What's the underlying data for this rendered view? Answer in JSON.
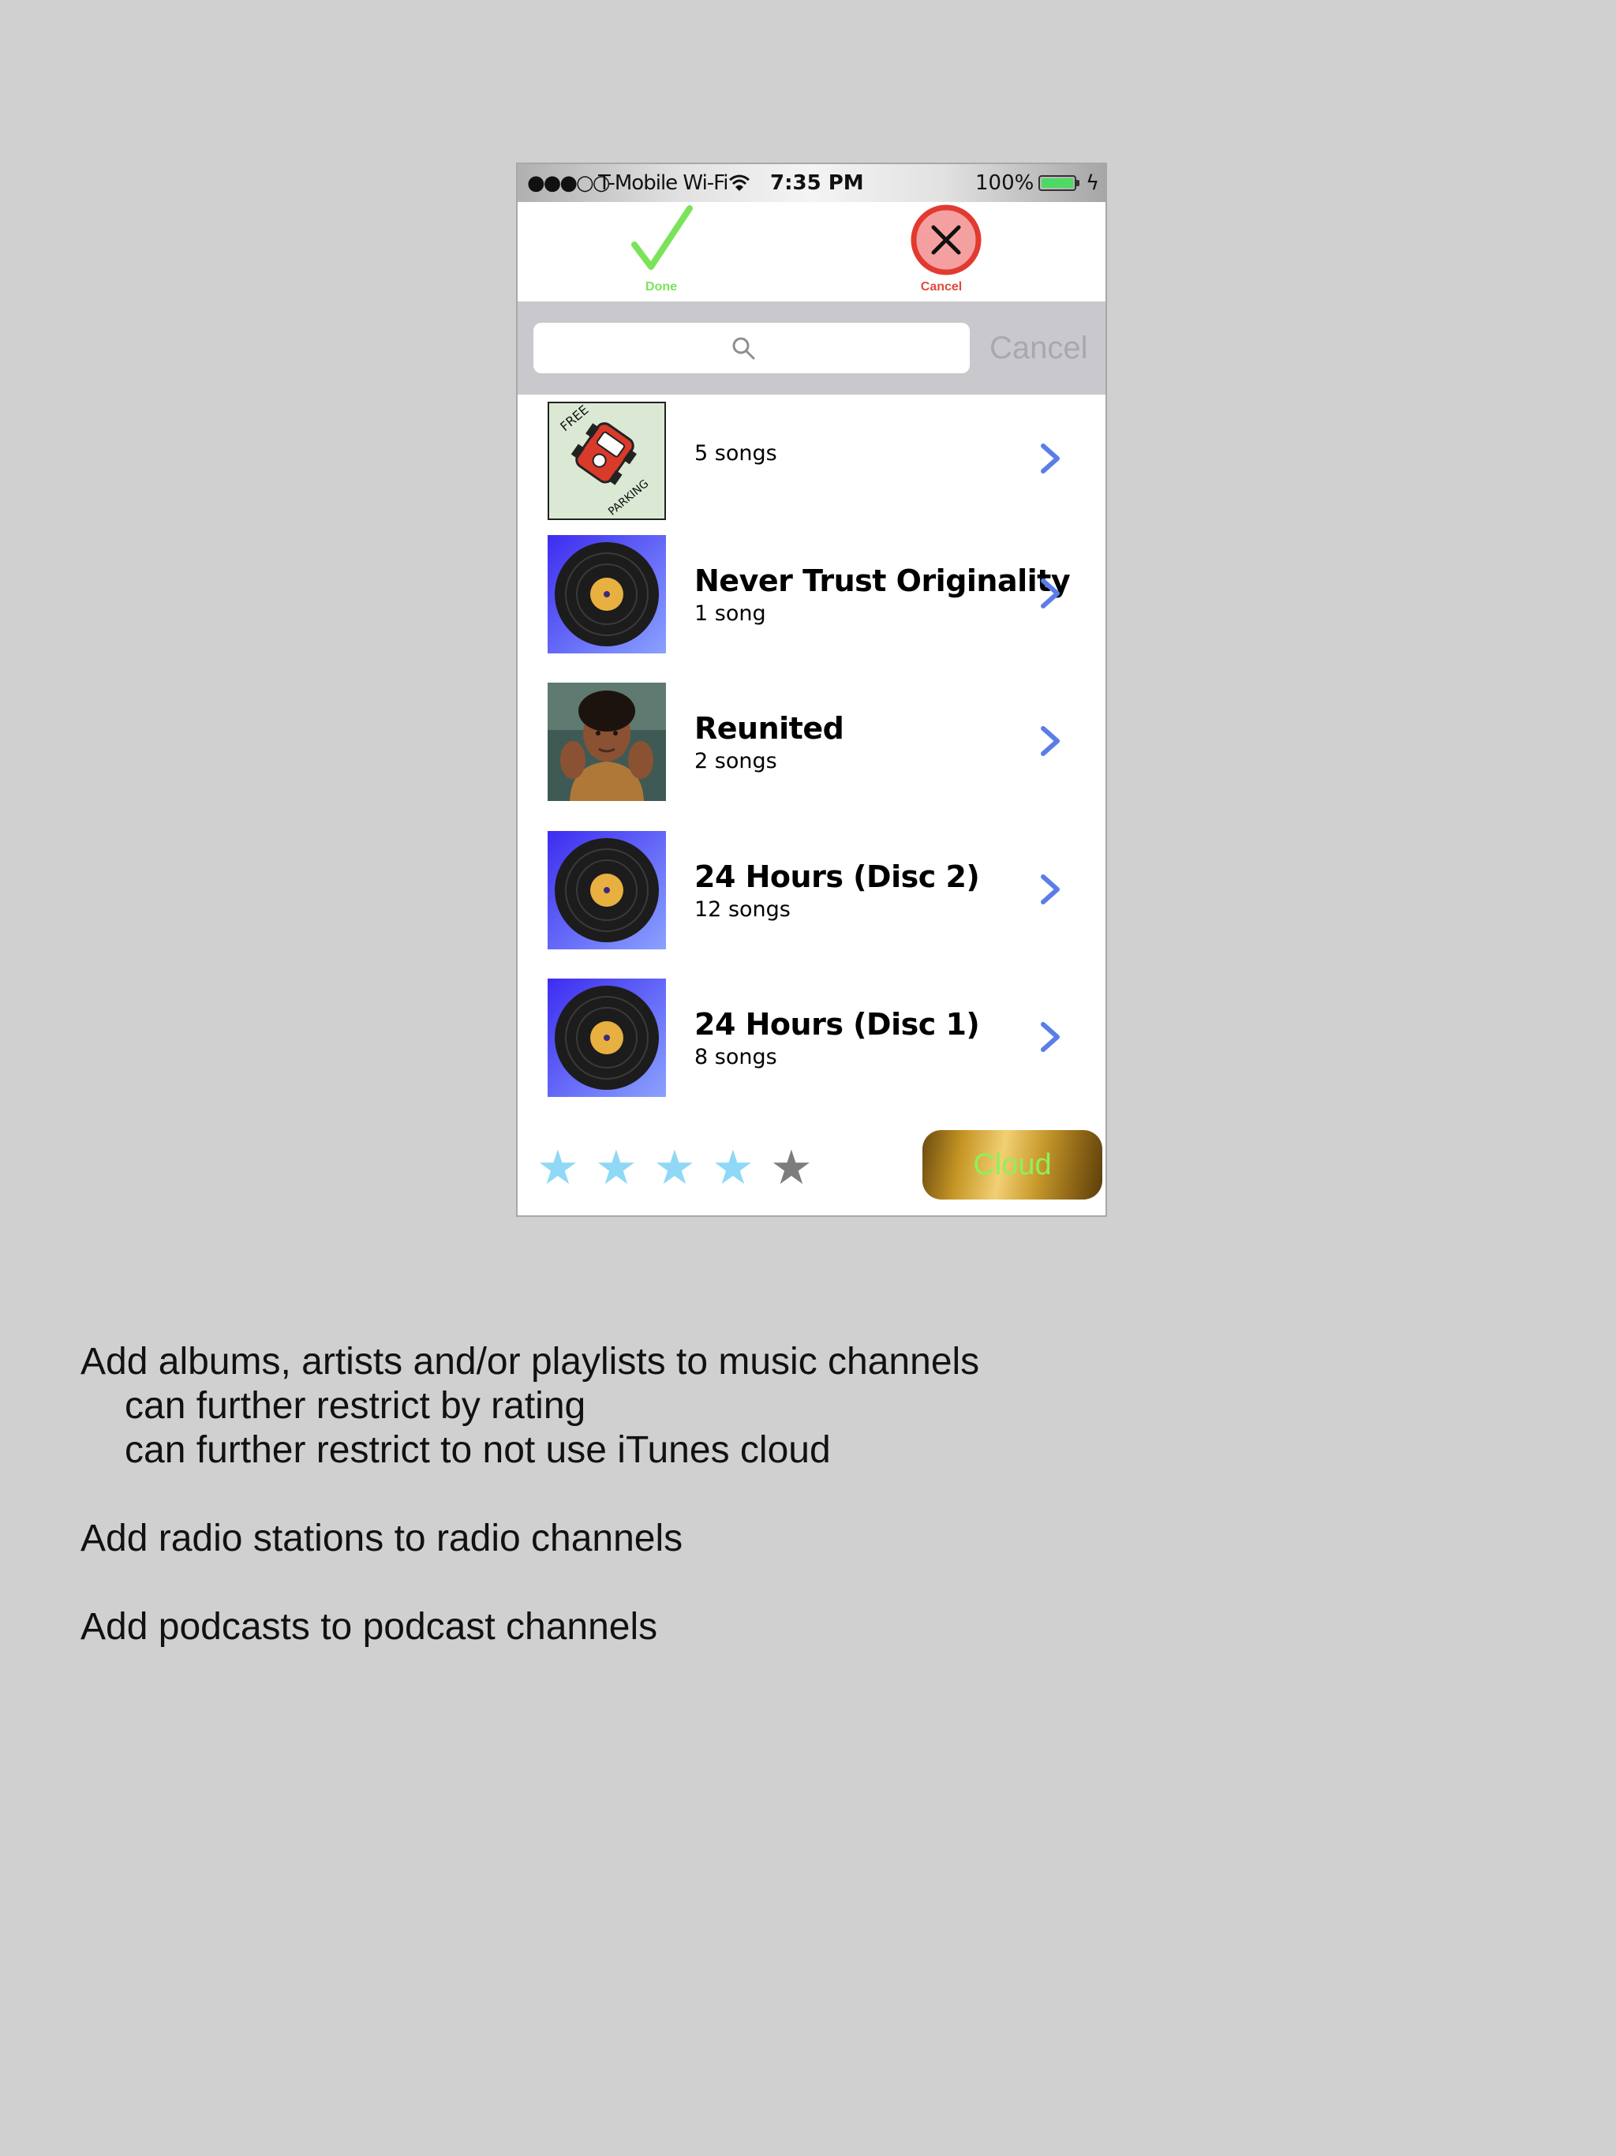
{
  "status_bar": {
    "signal": "●●●○○",
    "carrier": "T-Mobile Wi-Fi",
    "time": "7:35 PM",
    "battery_percent": "100%",
    "battery_level": 1.0,
    "charging_icon": "bolt-icon"
  },
  "toolbar": {
    "done_label": "Done",
    "cancel_label": "Cancel",
    "done_icon": "checkmark-icon",
    "cancel_icon": "x-circle-icon",
    "done_color": "#7be35a",
    "cancel_color": "#e04a3a"
  },
  "search": {
    "value": "",
    "placeholder": "",
    "cancel_label": "Cancel"
  },
  "albums": [
    {
      "title": "",
      "count": "5 songs",
      "art": "free-parking",
      "art_text_top": "FREE",
      "art_text_bottom": "PARKING"
    },
    {
      "title": "Never Trust Originality",
      "count": "1 song",
      "art": "vinyl-record"
    },
    {
      "title": "Reunited",
      "count": "2 songs",
      "art": "portrait-photo"
    },
    {
      "title": "24 Hours (Disc 2)",
      "count": "12 songs",
      "art": "vinyl-record"
    },
    {
      "title": "24 Hours (Disc 1)",
      "count": "8 songs",
      "art": "vinyl-record"
    }
  ],
  "rating": {
    "stars": [
      "★",
      "★",
      "★",
      "★",
      "★"
    ],
    "value": 4,
    "max": 5,
    "on_color": "#8fd8f6",
    "off_color": "#7d7d7d"
  },
  "cloud_button": {
    "label": "Cloud"
  },
  "description": {
    "music_line": "Add albums, artists and/or playlists to music channels",
    "rating_line": "can further restrict by rating",
    "cloud_line": "can further restrict to not use iTunes cloud",
    "radio_line": "Add radio stations to radio channels",
    "podcast_line": "Add podcasts to podcast channels"
  }
}
